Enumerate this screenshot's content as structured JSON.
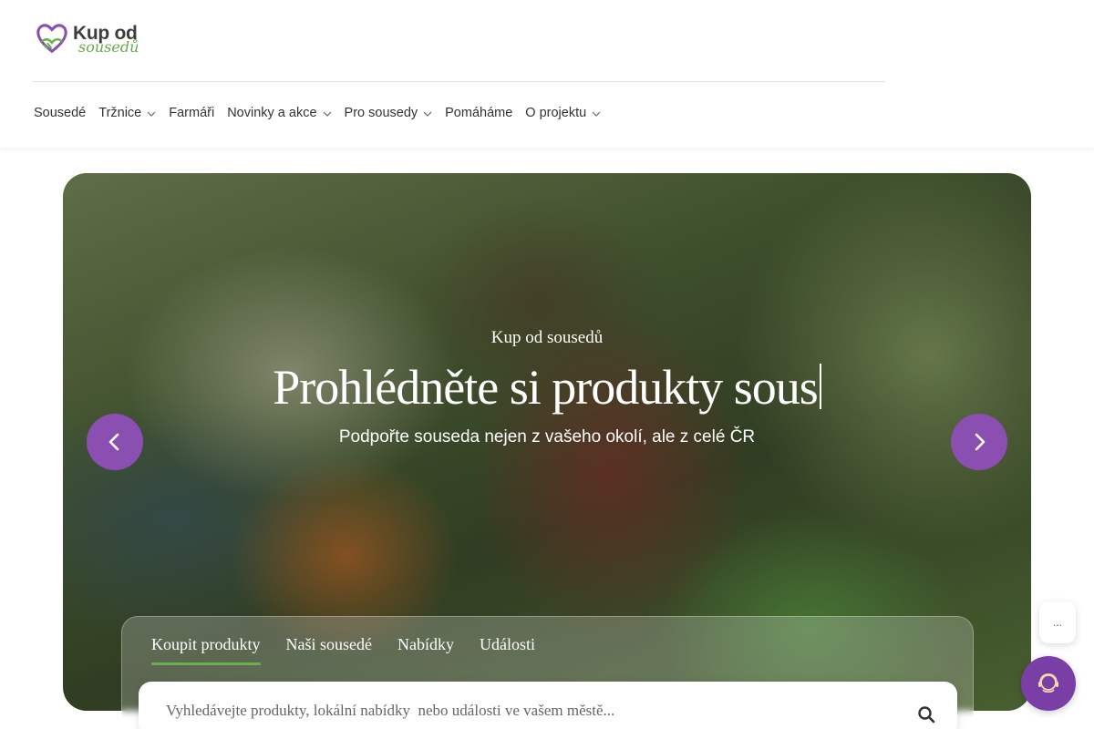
{
  "header": {
    "logo": {
      "line1": "Kup od",
      "line2": "sousedů"
    },
    "nav": [
      {
        "label": "Sousedé",
        "has_dropdown": false
      },
      {
        "label": "Tržnice",
        "has_dropdown": true
      },
      {
        "label": "Farmáři",
        "has_dropdown": false
      },
      {
        "label": "Novinky a akce",
        "has_dropdown": true
      },
      {
        "label": "Pro sousedy",
        "has_dropdown": true
      },
      {
        "label": "Pomáháme",
        "has_dropdown": false
      },
      {
        "label": "O projektu",
        "has_dropdown": true
      }
    ]
  },
  "hero": {
    "kicker": "Kup od sousedů",
    "title": "Prohlédněte si produkty sous",
    "subtitle": "Podpořte souseda nejen z vašeho okolí, ale z celé ČR",
    "prev_icon": "chevron-left-icon",
    "next_icon": "chevron-right-icon"
  },
  "search": {
    "tabs": [
      {
        "label": "Koupit produkty",
        "active": true
      },
      {
        "label": "Naši sousedé",
        "active": false
      },
      {
        "label": "Nabídky",
        "active": false
      },
      {
        "label": "Události",
        "active": false
      }
    ],
    "placeholder": "Vyhledávejte produkty, lokální nabídky  nebo události ve vašem městě...",
    "icon": "search-icon"
  },
  "chat": {
    "bubble_text": "...",
    "icon": "chat-agent-icon"
  },
  "colors": {
    "brand_purple": "#8a4fb0",
    "brand_green": "#6ab04c",
    "text_dark": "#333333"
  }
}
